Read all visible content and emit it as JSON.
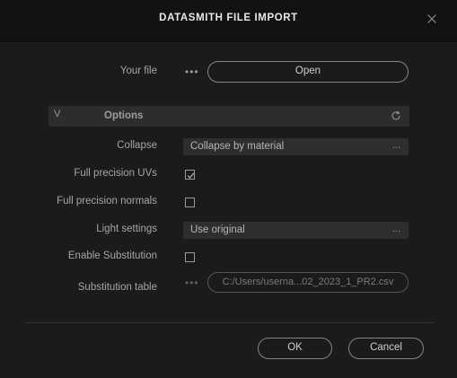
{
  "dialog": {
    "title": "DATASMITH FILE IMPORT",
    "close_icon": "close-icon"
  },
  "file": {
    "label": "Your file",
    "browse_dots": "•••",
    "open_label": "Open"
  },
  "options": {
    "chevron": "V",
    "title": "Options",
    "reset_icon": "reset-icon",
    "collapse": {
      "label": "Collapse",
      "value": "Collapse by material",
      "more": "..."
    },
    "full_precision_uvs": {
      "label": "Full precision UVs",
      "checked": true
    },
    "full_precision_normals": {
      "label": "Full precision normals",
      "checked": false
    },
    "light_settings": {
      "label": "Light settings",
      "value": "Use original",
      "more": "..."
    },
    "enable_substitution": {
      "label": "Enable Substitution",
      "checked": false
    },
    "substitution_table": {
      "label": "Substitution table",
      "dots": "•••",
      "value": "C:/Users/userna...02_2023_1_PR2.csv"
    }
  },
  "footer": {
    "ok_label": "OK",
    "cancel_label": "Cancel"
  },
  "colors": {
    "background": "#1b1b1b",
    "titlebar": "#121212",
    "section": "#2d2d2d",
    "field": "#2e2e2e",
    "border": "#858585"
  }
}
